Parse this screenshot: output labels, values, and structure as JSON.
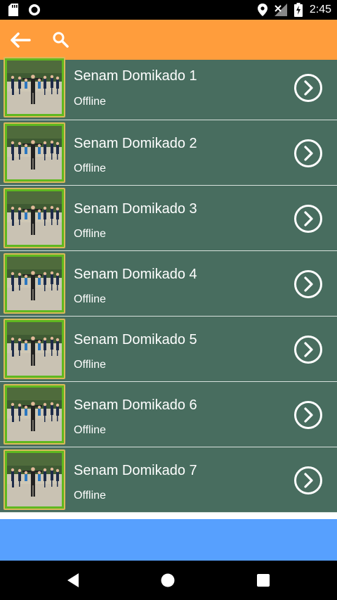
{
  "status_bar": {
    "time": "2:45",
    "icons": [
      "sd-card-icon",
      "circle-notification-icon",
      "location-icon",
      "signal-no-data-icon",
      "battery-charging-icon"
    ]
  },
  "toolbar": {
    "background": "#ff9d3c",
    "icons": [
      "back-arrow-icon",
      "search-icon"
    ]
  },
  "list": {
    "row_background": "#486d5f",
    "items": [
      {
        "title": "Senam Domikado 1",
        "subtitle": "Offline"
      },
      {
        "title": "Senam Domikado 2",
        "subtitle": "Offline"
      },
      {
        "title": "Senam Domikado 3",
        "subtitle": "Offline"
      },
      {
        "title": "Senam Domikado 4",
        "subtitle": "Offline"
      },
      {
        "title": "Senam Domikado 5",
        "subtitle": "Offline"
      },
      {
        "title": "Senam Domikado 6",
        "subtitle": "Offline"
      },
      {
        "title": "Senam Domikado 7",
        "subtitle": "Offline"
      }
    ]
  },
  "banner": {
    "background": "#57a0fe"
  },
  "nav_bar": {
    "icons": [
      "nav-back-icon",
      "nav-home-icon",
      "nav-recents-icon"
    ]
  }
}
